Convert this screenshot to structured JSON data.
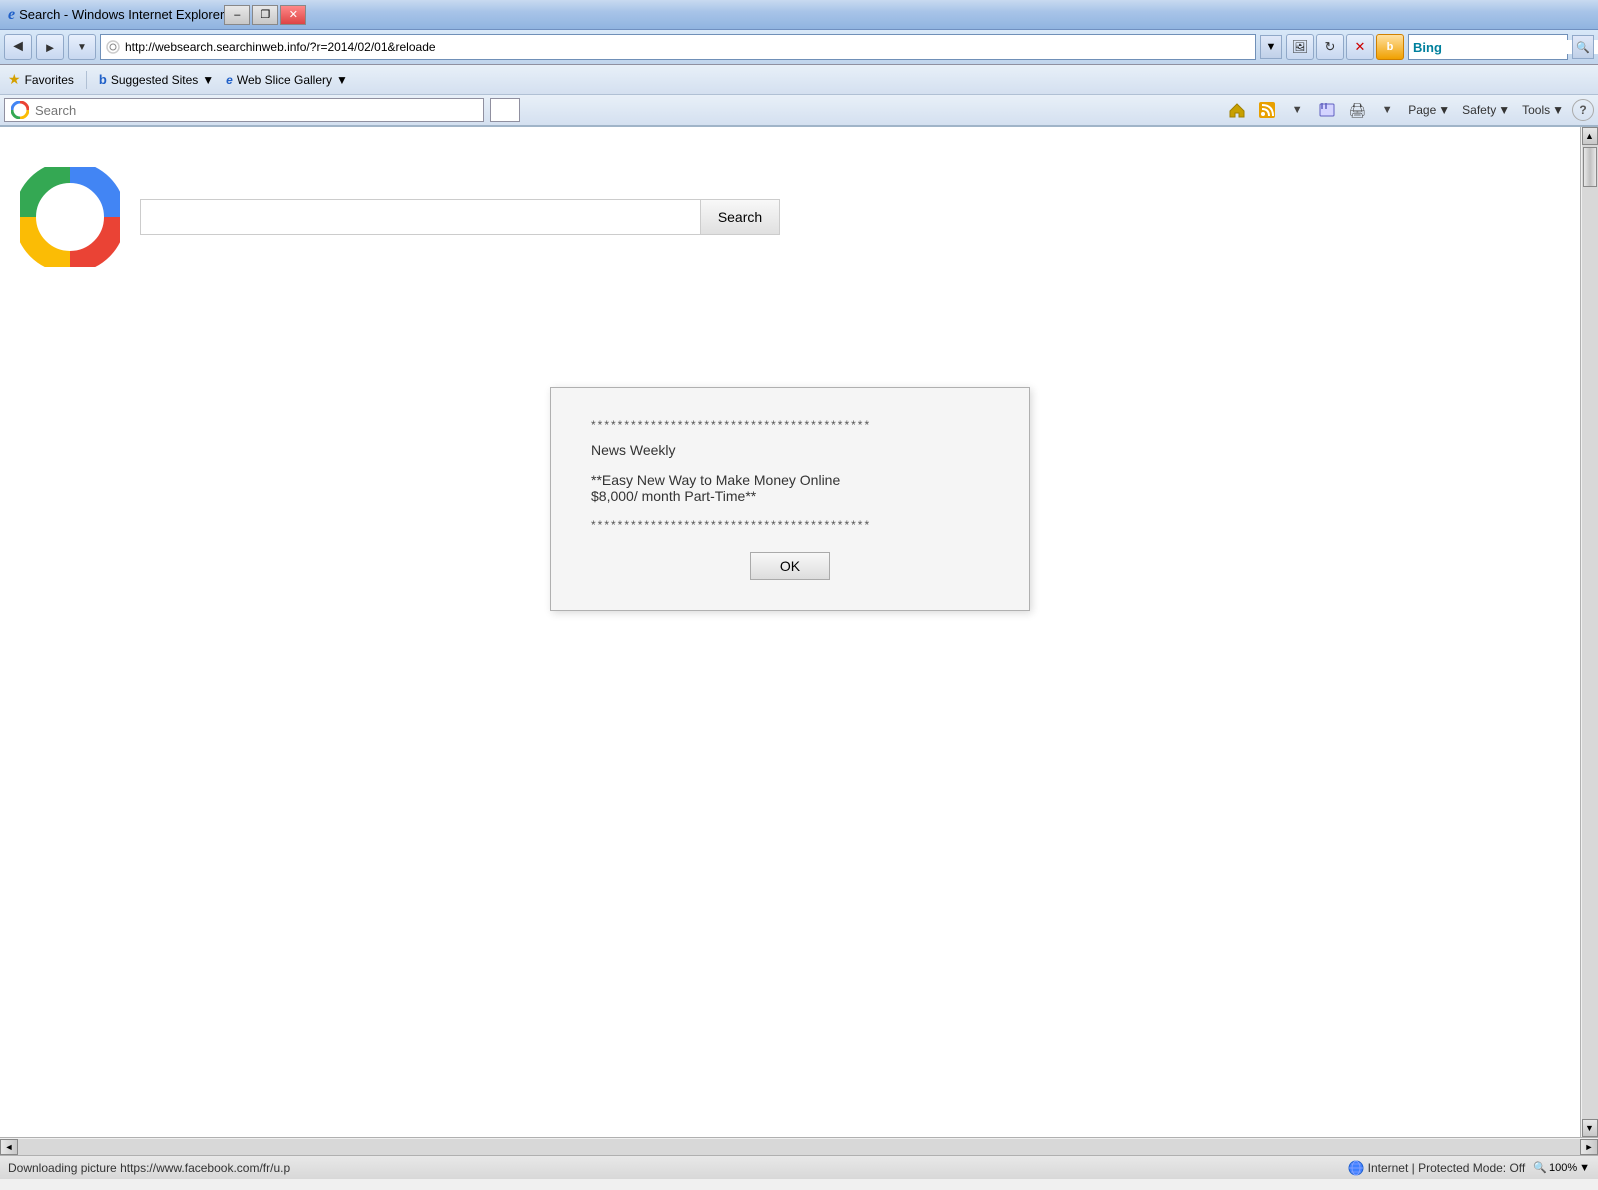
{
  "window": {
    "title": "Search - Windows Internet Explorer",
    "title_icon": "IE",
    "buttons": {
      "minimize": "–",
      "restore": "❐",
      "close": "✕"
    }
  },
  "address_bar": {
    "url": "http://websearch.searchinweb.info/?r=2014/02/01&reloade",
    "dropdown_arrow": "▼",
    "bing_placeholder": "",
    "bing_label": "Bing"
  },
  "nav_buttons": {
    "back": "◄",
    "forward": "►",
    "dropdown": "▼",
    "refresh": "↻",
    "stop": "✕",
    "home": "⌂",
    "rss": "☰",
    "print": "🖨",
    "search": "🔍"
  },
  "favorites_bar": {
    "favorites_label": "Favorites",
    "favorites_star": "★",
    "suggested_sites_label": "Suggested Sites",
    "suggested_dropdown": "▼",
    "web_slice_label": "Web Slice Gallery",
    "web_slice_dropdown": "▼"
  },
  "ie_toolbar": {
    "search_placeholder": "Search",
    "tab_placeholder": "",
    "home_icon": "⌂",
    "rss_icon": "▤",
    "rss_dropdown": "▼",
    "favorites_icon": "★",
    "print_icon": "🖨",
    "print_dropdown": "▼",
    "page_label": "Page",
    "page_dropdown": "▼",
    "safety_label": "Safety",
    "safety_dropdown": "▼",
    "tools_label": "Tools",
    "tools_dropdown": "▼",
    "help_icon": "?"
  },
  "main_page": {
    "search_input_value": "",
    "search_button_label": "Search"
  },
  "ad_dialog": {
    "stars_top": "******************************************",
    "title": "News Weekly",
    "body": "**Easy New Way to Make Money Online\n$8,000/ month Part-Time**",
    "stars_bottom": "******************************************",
    "ok_label": "OK"
  },
  "status_bar": {
    "status_text": "Downloading picture https://www.facebook.com/fr/u.p",
    "zone_icon": "🌐",
    "zone_text": "Internet | Protected Mode: Off",
    "zoom_icon": "🔍",
    "zoom_text": "100%",
    "zoom_dropdown": "▼"
  },
  "scrollbar": {
    "up": "▲",
    "down": "▼",
    "left": "◄",
    "right": "►"
  }
}
